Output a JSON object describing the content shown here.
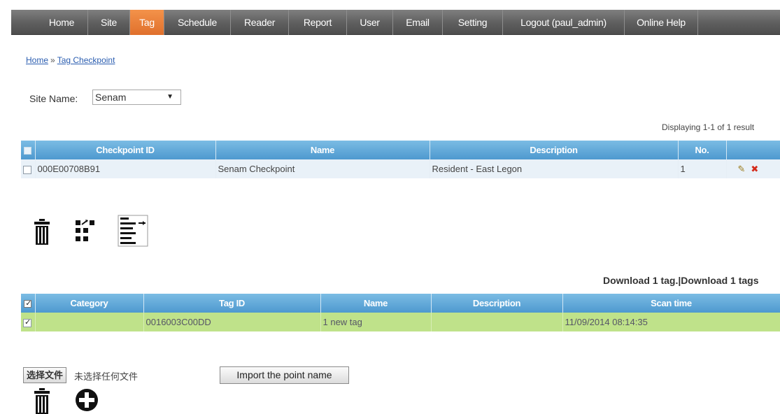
{
  "nav": {
    "items": [
      "Home",
      "Site",
      "Tag",
      "Schedule",
      "Reader",
      "Report",
      "User",
      "Email",
      "Setting",
      "Logout (paul_admin)",
      "Online Help"
    ],
    "active": "Tag"
  },
  "breadcrumb": {
    "home": "Home",
    "separator": "»",
    "current": "Tag Checkpoint"
  },
  "site": {
    "label": "Site Name:",
    "selected": "Senam"
  },
  "checkpoints": {
    "displaying": "Displaying 1-1 of 1 result",
    "headers": [
      "Checkpoint ID",
      "Name",
      "Description",
      "No."
    ],
    "rows": [
      {
        "checkpoint_id": "000E00708B91",
        "name": "Senam Checkpoint",
        "description": "Resident - East Legon",
        "no": "1"
      }
    ]
  },
  "icons": {
    "delete": "trash-icon",
    "move": "grid-move-icon",
    "list": "list-add-icon",
    "add": "plus-circle-icon",
    "edit": "pencil-icon",
    "remove": "x-icon"
  },
  "tags": {
    "download_links": [
      "Download 1 tag.",
      "Download 1 tags"
    ],
    "link_separator": "|",
    "headers": [
      "Category",
      "Tag ID",
      "Name",
      "Description",
      "Scan time"
    ],
    "rows": [
      {
        "category": "",
        "tag_id": "0016003C00DD",
        "name": "1 new tag",
        "description": "",
        "scan_time": "11/09/2014 08:14:35"
      }
    ]
  },
  "file": {
    "choose_label": "选择文件",
    "status": "未选择任何文件"
  },
  "import_label": "Import the point name",
  "colors": {
    "nav_active": "#e8782f",
    "header_blue": "#5ea6d8",
    "tag_row_green": "#bfe28a"
  }
}
